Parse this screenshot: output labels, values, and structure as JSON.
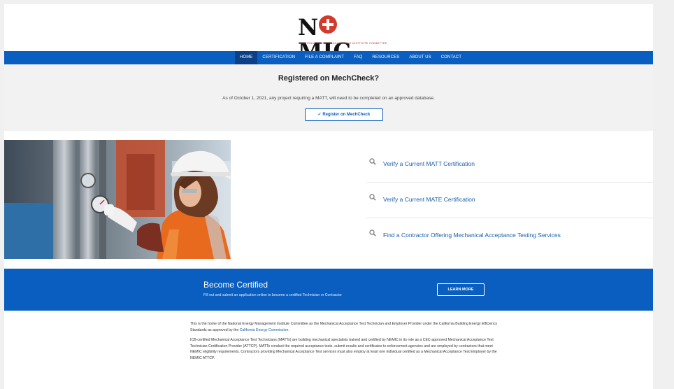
{
  "logo": {
    "word_left": "N",
    "word_right": "MIC",
    "tagline": "NATIONAL ENERGY MANAGEMENT INSTITUTE COMMITTEE"
  },
  "nav": {
    "items": [
      "HOME",
      "CERTIFICATION",
      "FILE A COMPLAINT",
      "FAQ",
      "RESOURCES",
      "ABOUT US",
      "CONTACT"
    ]
  },
  "registered": {
    "title": "Registered on MechCheck?",
    "text": "As of October 1, 2021, any project requiring a MATT, will need to be completed on an approved database.",
    "button": "Register on MechCheck",
    "button_icon": "check-icon"
  },
  "links": [
    {
      "label": "Verify a Current MATT Certification",
      "icon": "search-icon"
    },
    {
      "label": "Verify a Current MATE Certification",
      "icon": "search-icon"
    },
    {
      "label": "Find a Contractor Offering Mechanical Acceptance Testing Services",
      "icon": "search-icon"
    }
  ],
  "certified": {
    "title": "Become Certified",
    "subtitle": "Fill out and submit an application online to become a certified Technician or Contractor",
    "button": "LEARN MORE"
  },
  "body": {
    "p1_before": "This is the home of the National Energy Management Institute Committee as the Mechanical Acceptance Test Technician and Employer Provider under the California Building Energy Efficiency Standards as approved by the ",
    "p1_link": "California Energy Commission",
    "p1_after": ".",
    "p2": "ICB-certified Mechanical Acceptance Test Technicians (MATTs) are building mechanical specialists trained and certified by NEMIC in its role as a CEC-approved Mechanical Acceptance Test Technician Certification Provider (ATTCP). MATTs conduct the required acceptance tests, submit results and certificates to enforcement agencies and are employed by contractors that meet NEMIC eligibility requirements. Contractors providing Mechanical Acceptance Test services must also employ at least one individual certified as a Mechanical Acceptance Test Employer by the NEMIC ATTCP."
  },
  "colors": {
    "brand_blue": "#0a5ec0",
    "nav_active": "#0b3f86",
    "logo_red": "#d23b2b",
    "link_blue": "#1a5fa8"
  }
}
